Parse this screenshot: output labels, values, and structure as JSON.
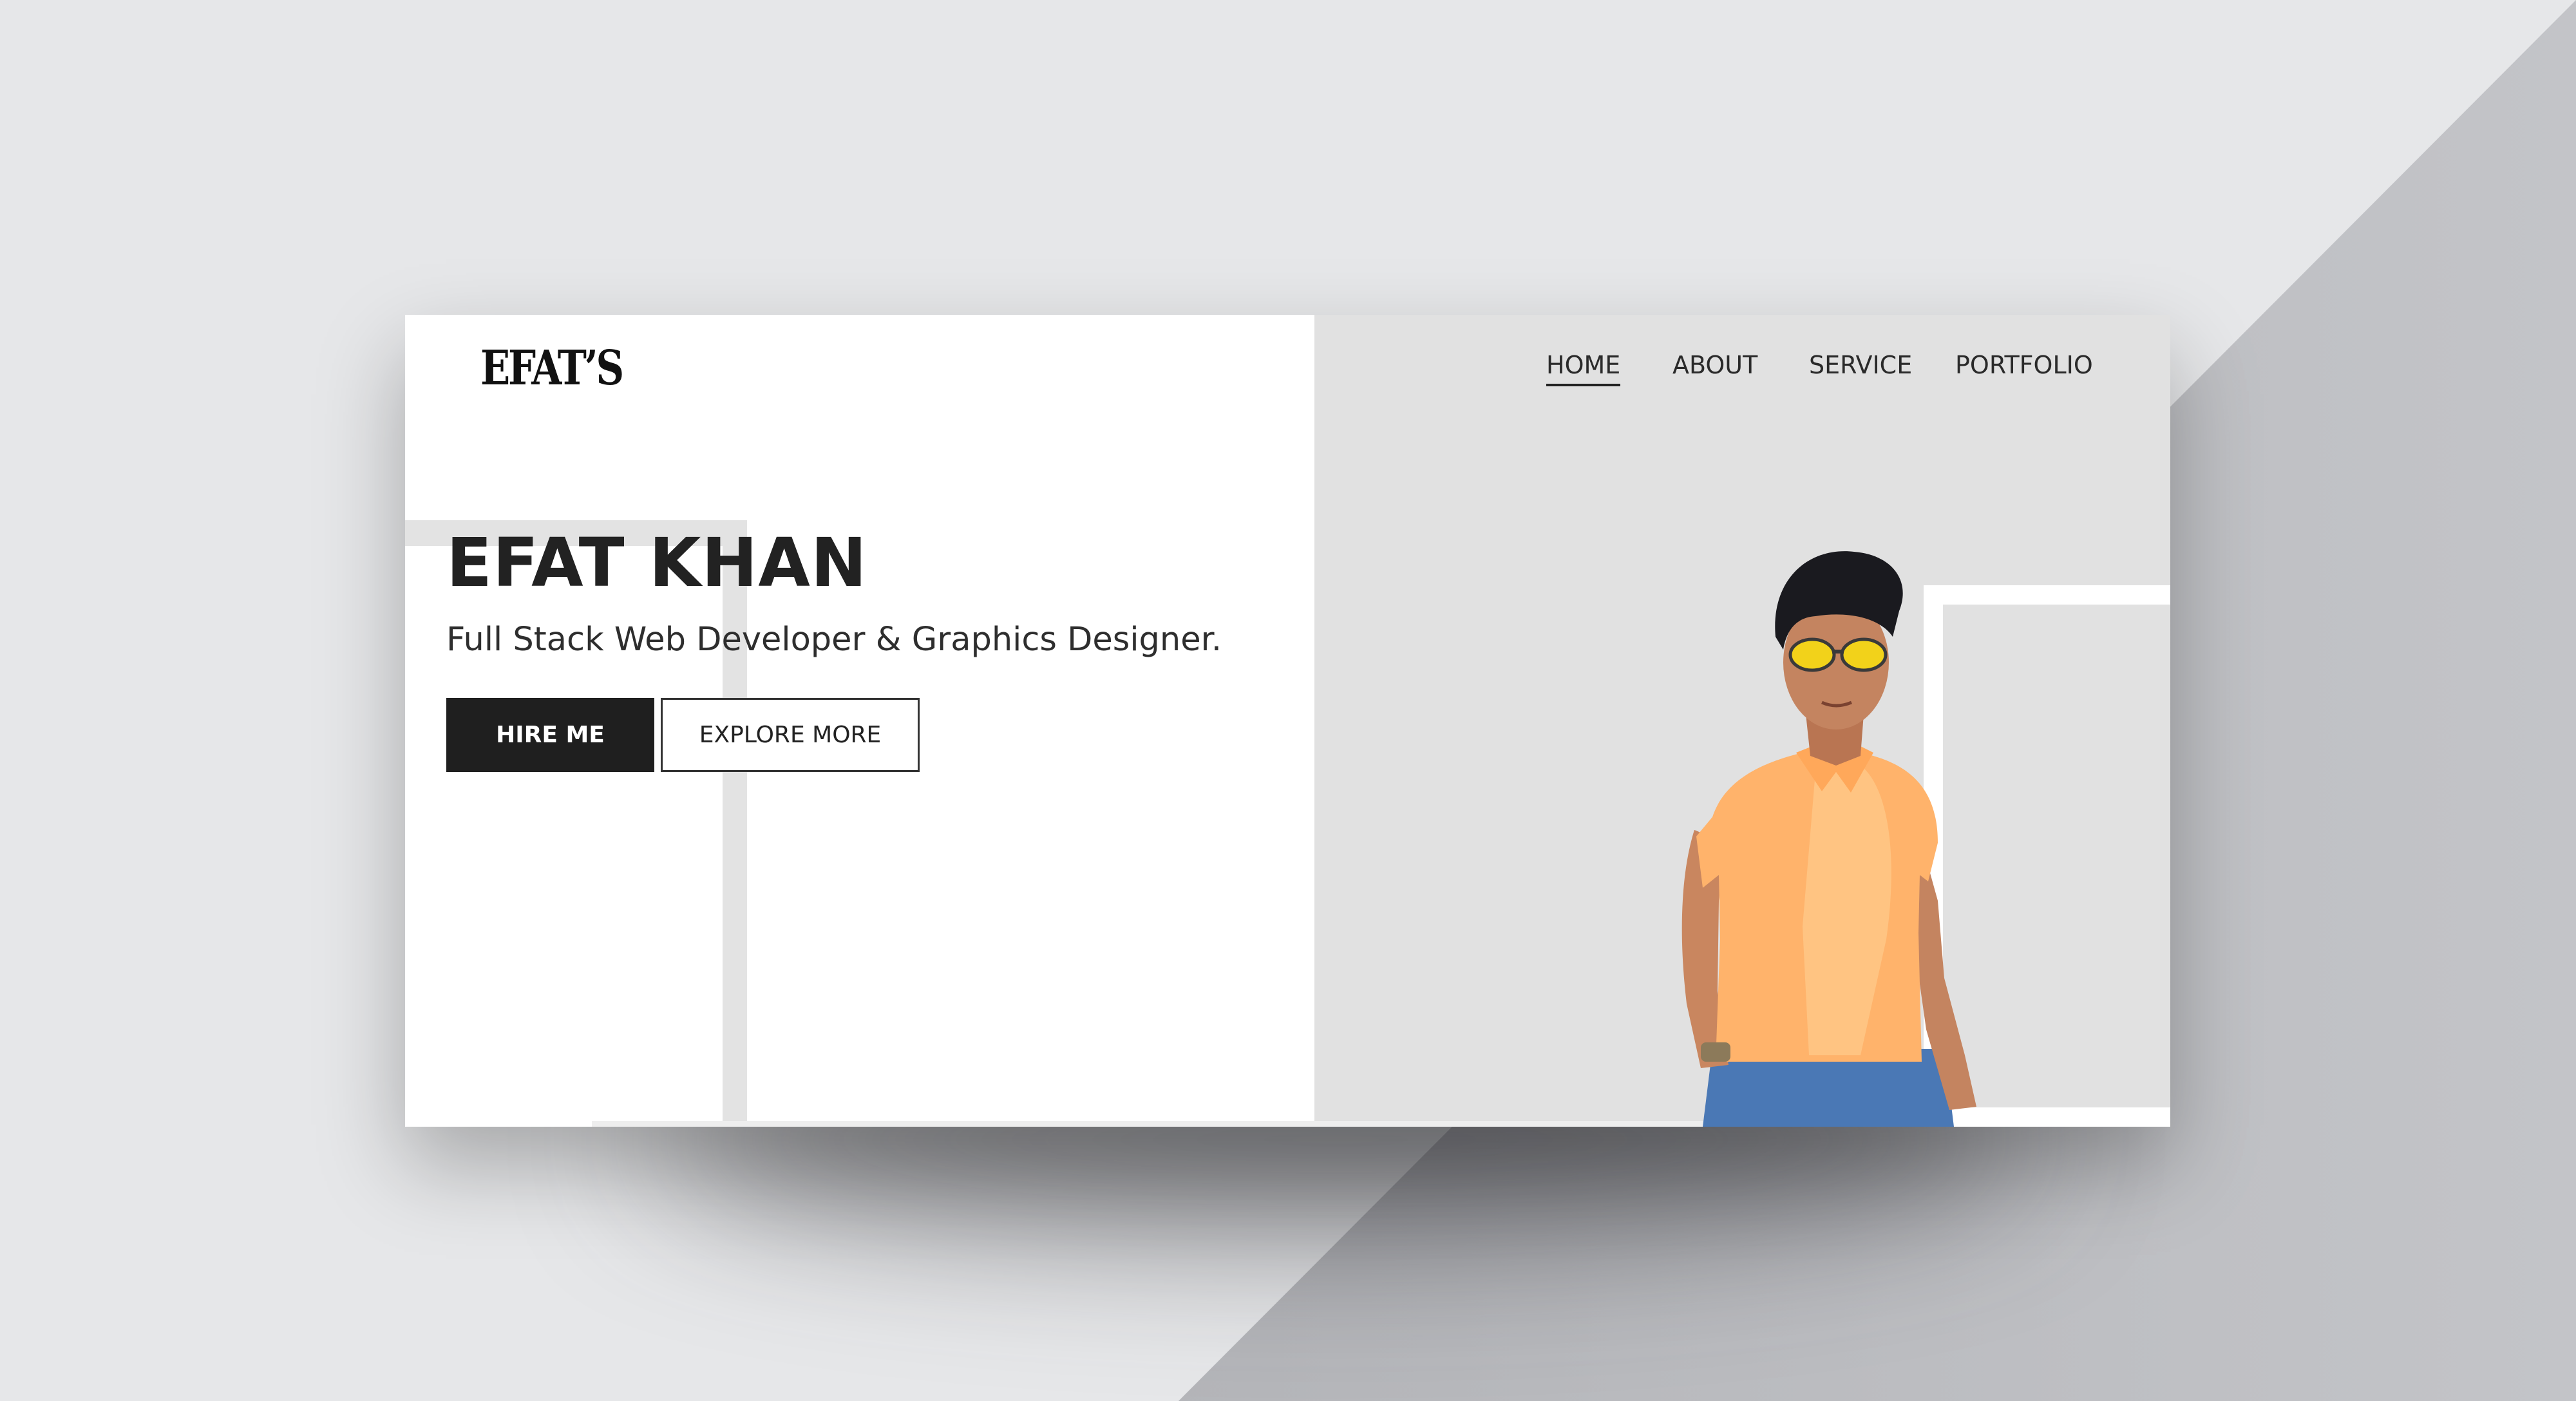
{
  "page": {
    "background_color": "#e6e7e9",
    "diagonal_color": "#b4b5b9"
  },
  "header": {
    "logo": "EFAT’S",
    "nav": [
      {
        "label": "HOME",
        "active": true
      },
      {
        "label": "ABOUT",
        "active": false
      },
      {
        "label": "SERVICE",
        "active": false
      },
      {
        "label": "PORTFOLIO",
        "active": false
      }
    ]
  },
  "hero": {
    "name": "EFAT KHAN",
    "subtitle": "Full Stack Web Developer & Graphics Designer.",
    "primary_button": "HIRE ME",
    "secondary_button": "EXPLORE MORE"
  },
  "colors": {
    "primary_button_bg": "#1f1f1f",
    "text_dark": "#222222",
    "right_panel_bg": "#e1e1e1",
    "shirt": "#ffb36b",
    "jeans": "#4a78b5"
  }
}
